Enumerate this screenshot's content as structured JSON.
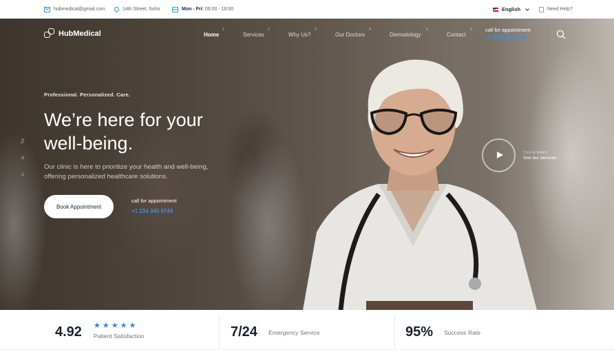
{
  "topbar": {
    "email": "hubmedical@gmail.com",
    "address": "14th Street, Soho",
    "hours_bold": "Mon - Fri:",
    "hours": "09:00 - 18:00",
    "language": "English",
    "help": "Need Help?"
  },
  "logo": {
    "text": "HubMedical"
  },
  "nav": {
    "items": [
      {
        "label": "Home",
        "num": "1"
      },
      {
        "label": "Services",
        "num": "2"
      },
      {
        "label": "Why Us?",
        "num": "3"
      },
      {
        "label": "Our Doctors",
        "num": "4"
      },
      {
        "label": "Dermatology",
        "num": "5"
      },
      {
        "label": "Contact",
        "num": "6"
      }
    ],
    "call_label": "call for appointment",
    "call_phone": "+1 234 345 6744"
  },
  "hero": {
    "eyebrow": "Professional. Personalized. Care.",
    "headline_pre": "We’re ",
    "headline_highlight": "here",
    "headline_post": " for your well-being.",
    "lead": "Our clinic is here to prioritize your health and well-being, offering personalized healthcare solutions.",
    "book_button": "Book Appointment",
    "cta_label": "call for appointment",
    "cta_phone": "+1 234 345 6744",
    "social": [
      "Tw",
      "In",
      "Li"
    ],
    "play_label": "Click to Watch",
    "play_link": "See our services"
  },
  "stats": [
    {
      "value": "4.92",
      "label": "Patient Satisfaction",
      "stars": 5
    },
    {
      "value": "7/24",
      "label": "Emergency Service"
    },
    {
      "value": "95%",
      "label": "Success Rate"
    }
  ],
  "colors": {
    "accent": "#3a8fe0",
    "dark": "#1c222c"
  }
}
